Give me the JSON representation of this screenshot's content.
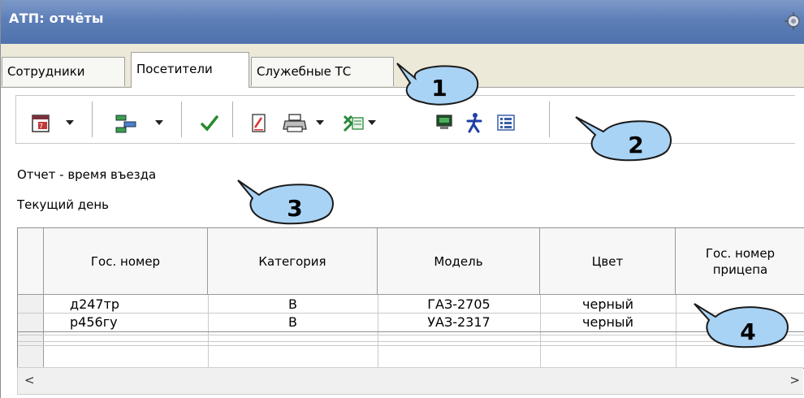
{
  "window": {
    "title": "АТП: отчёты",
    "title_icon": "settings-icon"
  },
  "tabs": [
    {
      "label": "Сотрудники",
      "active": false
    },
    {
      "label": "Посетители",
      "active": true
    },
    {
      "label": "Служебные ТС",
      "active": false
    }
  ],
  "toolbar": {
    "buttons": [
      {
        "icon": "calendar-icon",
        "dropdown": true
      },
      {
        "icon": "tree-structure-icon",
        "dropdown": true
      },
      {
        "icon": "checkmark-icon",
        "dropdown": false
      },
      {
        "icon": "document-edit-icon",
        "dropdown": false
      },
      {
        "icon": "printer-icon",
        "dropdown": true
      },
      {
        "icon": "excel-icon",
        "dropdown": true
      },
      {
        "icon": "monitor-icon",
        "dropdown": false
      },
      {
        "icon": "person-icon",
        "dropdown": false
      },
      {
        "icon": "list-view-icon",
        "dropdown": false
      }
    ]
  },
  "report": {
    "title": "Отчет - время въезда",
    "period": "Текущий день"
  },
  "table": {
    "columns": [
      "Гос. номер",
      "Категория",
      "Модель",
      "Цвет",
      "Гос. номер прицепа"
    ],
    "rows": [
      [
        "д247тр",
        "B",
        "ГАЗ-2705",
        "черный",
        ""
      ],
      [
        "р456гу",
        "B",
        "УАЗ-2317",
        "черный",
        ""
      ]
    ]
  },
  "scrollbar": {
    "left_arrow": "<",
    "right_arrow": ">"
  },
  "callouts": [
    "1",
    "2",
    "3",
    "4"
  ],
  "colors": {
    "titlebar": "#5d7fb8",
    "callout_fill": "#a9d3f5",
    "callout_stroke": "#1a1a1a"
  }
}
